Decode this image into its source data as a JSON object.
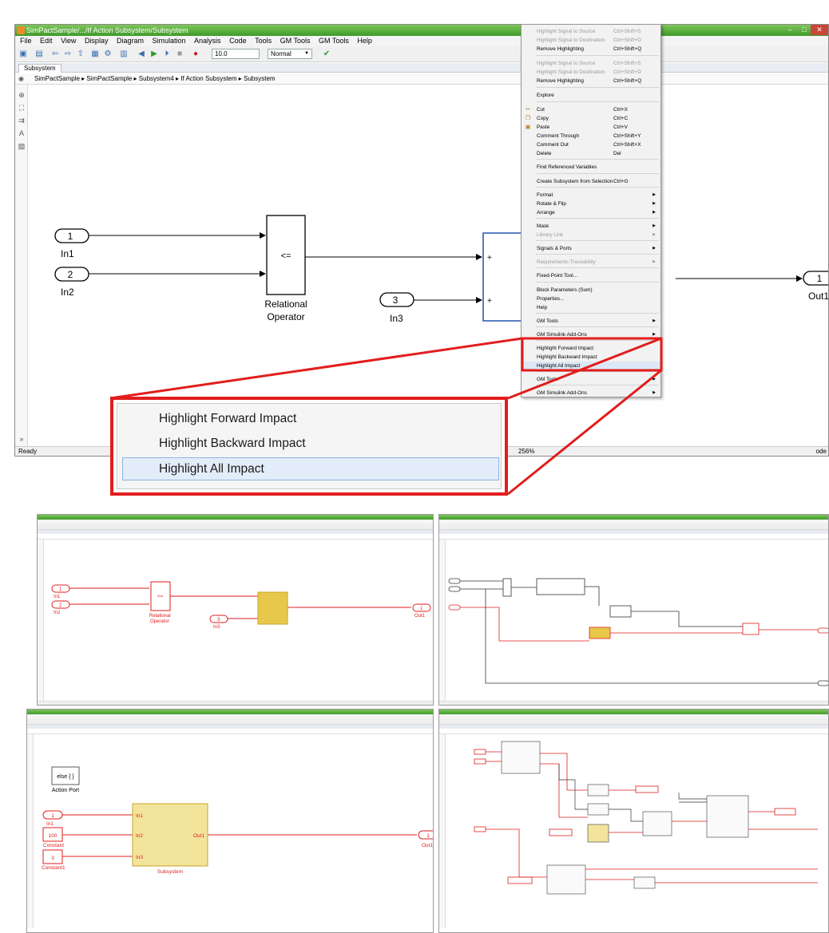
{
  "main_window": {
    "title": "SimPactSample/.../If Action Subsystem/Subsystem",
    "menu": [
      "File",
      "Edit",
      "View",
      "Display",
      "Diagram",
      "Simulation",
      "Analysis",
      "Code",
      "Tools",
      "GM Tools",
      "GM Tools",
      "Help"
    ],
    "toolbar": {
      "stop_time": "10.0",
      "sim_mode": "Normal"
    },
    "tab": "Subsystem",
    "breadcrumb": [
      "SimPactSample",
      "SimPactSample",
      "Subsystem4",
      "If Action Subsystem",
      "Subsystem"
    ],
    "status": "Ready",
    "zoom": "256%",
    "status_right": "ode"
  },
  "diagram": {
    "in1": {
      "num": "1",
      "label": "In1"
    },
    "in2": {
      "num": "2",
      "label": "In2"
    },
    "in3": {
      "num": "3",
      "label": "In3"
    },
    "relop": {
      "symbol": "<=",
      "label_line1": "Relational",
      "label_line2": "Operator"
    },
    "sum_signs": [
      "+",
      "+"
    ],
    "out1": {
      "num": "1",
      "label": "Out1"
    }
  },
  "context_menu": {
    "items": [
      {
        "label": "Highlight Signal to Source",
        "shortcut": "Ctrl+Shift+S",
        "disabled": true
      },
      {
        "label": "Highlight Signal to Destination",
        "shortcut": "Ctrl+Shift+D",
        "disabled": true
      },
      {
        "label": "Remove Highlighting",
        "shortcut": "Ctrl+Shift+Q"
      },
      {
        "label": "Highlight Signal to Source",
        "shortcut": "Ctrl+Shift+S",
        "disabled": true
      },
      {
        "label": "Highlight Signal to Destination",
        "shortcut": "Ctrl+Shift+D",
        "disabled": true
      },
      {
        "label": "Remove Highlighting",
        "shortcut": "Ctrl+Shift+Q"
      },
      {
        "label": "Explore"
      },
      {
        "label": "Cut",
        "shortcut": "Ctrl+X",
        "icon": "scissors-icon"
      },
      {
        "label": "Copy",
        "shortcut": "Ctrl+C",
        "icon": "copy-icon"
      },
      {
        "label": "Paste",
        "shortcut": "Ctrl+V",
        "icon": "paste-icon"
      },
      {
        "label": "Comment Through",
        "shortcut": "Ctrl+Shift+Y"
      },
      {
        "label": "Comment Out",
        "shortcut": "Ctrl+Shift+X"
      },
      {
        "label": "Delete",
        "shortcut": "Del"
      },
      {
        "label": "Find Referenced Variables"
      },
      {
        "label": "Create Subsystem from Selection",
        "shortcut": "Ctrl+G"
      },
      {
        "label": "Format",
        "submenu": true
      },
      {
        "label": "Rotate & Flip",
        "submenu": true
      },
      {
        "label": "Arrange",
        "submenu": true
      },
      {
        "label": "Mask",
        "submenu": true
      },
      {
        "label": "Library Link",
        "submenu": true,
        "disabled": true
      },
      {
        "label": "Signals & Ports",
        "submenu": true
      },
      {
        "label": "Requirements Traceability",
        "submenu": true,
        "disabled": true
      },
      {
        "label": "Fixed-Point Tool..."
      },
      {
        "label": "Block Parameters (Sum)"
      },
      {
        "label": "Properties..."
      },
      {
        "label": "Help"
      },
      {
        "label": "GM Tools",
        "submenu": true
      },
      {
        "label": "GM Simulink Add-Ons",
        "submenu": true
      },
      {
        "label": "Highlight Forward Impact"
      },
      {
        "label": "Highlight Backward Impact"
      },
      {
        "label": "Highlight All Impact"
      },
      {
        "label": "GM Tools",
        "submenu": true
      },
      {
        "label": "GM Simulink Add-Ons",
        "submenu": true
      }
    ]
  },
  "callout": {
    "items": [
      "Highlight Forward Impact",
      "Highlight Backward Impact",
      "Highlight All Impact"
    ],
    "highlighted_index": 2
  },
  "thumb_a": {
    "in1": "1",
    "in1_label": "In1",
    "in2": "2",
    "in2_label": "In2",
    "in3": "3",
    "in3_label": "In3",
    "relop": "<=",
    "relop_label1": "Relational",
    "relop_label2": "Operator",
    "out1": "1",
    "out1_label": "Out1"
  },
  "thumb_c": {
    "action_port": "else { }",
    "action_port_label": "Action Port",
    "in1": "1",
    "in1_label": "In1",
    "c1": "100",
    "c1_label": "Constant",
    "c2": "3",
    "c2_label": "Constant1",
    "ports_in": [
      "In1",
      "In2",
      "In3"
    ],
    "port_out": "Out1",
    "subsystem_label": "Subsystem",
    "out1": "1",
    "out1_label": "Out1"
  },
  "colors": {
    "highlight_red": "#e21d1d",
    "block_yellow": "#e8c84a",
    "menu_hover": "#e3edf9",
    "title_green": "#4fae34"
  }
}
